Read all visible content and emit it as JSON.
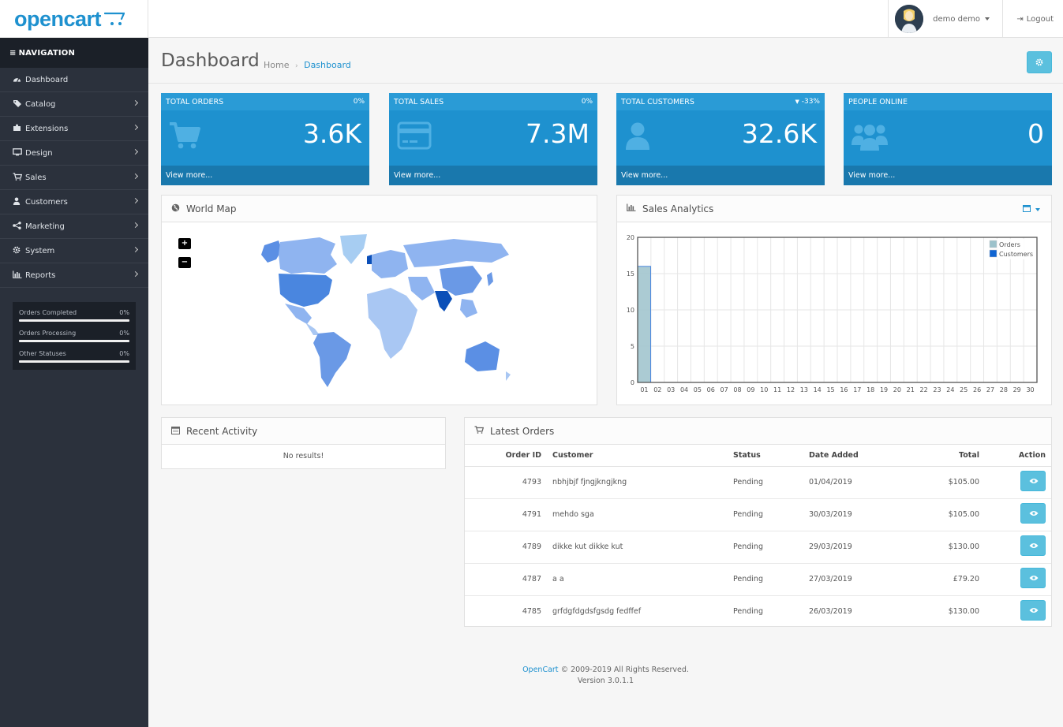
{
  "header": {
    "logo_text": "opencart",
    "user_name": "demo demo",
    "logout_label": "Logout"
  },
  "navigation": {
    "title": "NAVIGATION",
    "items": [
      {
        "label": "Dashboard",
        "icon": "dashboard-icon",
        "has_children": false
      },
      {
        "label": "Catalog",
        "icon": "tag-icon",
        "has_children": true
      },
      {
        "label": "Extensions",
        "icon": "puzzle-icon",
        "has_children": true
      },
      {
        "label": "Design",
        "icon": "monitor-icon",
        "has_children": true
      },
      {
        "label": "Sales",
        "icon": "cart-icon",
        "has_children": true
      },
      {
        "label": "Customers",
        "icon": "user-icon",
        "has_children": true
      },
      {
        "label": "Marketing",
        "icon": "share-icon",
        "has_children": true
      },
      {
        "label": "System",
        "icon": "gear-icon",
        "has_children": true
      },
      {
        "label": "Reports",
        "icon": "bar-chart-icon",
        "has_children": true
      }
    ],
    "order_stats": [
      {
        "label": "Orders Completed",
        "percent": "0%"
      },
      {
        "label": "Orders Processing",
        "percent": "0%"
      },
      {
        "label": "Other Statuses",
        "percent": "0%"
      }
    ]
  },
  "page": {
    "title": "Dashboard",
    "breadcrumb_home": "Home",
    "breadcrumb_current": "Dashboard"
  },
  "tiles": [
    {
      "title": "TOTAL ORDERS",
      "percent": "0%",
      "value": "3.6K",
      "footer": "View more...",
      "icon": "cart-icon"
    },
    {
      "title": "TOTAL SALES",
      "percent": "0%",
      "value": "7.3M",
      "footer": "View more...",
      "icon": "credit-card-icon"
    },
    {
      "title": "TOTAL CUSTOMERS",
      "percent": "-33%",
      "value": "32.6K",
      "footer": "View more...",
      "icon": "user-icon"
    },
    {
      "title": "PEOPLE ONLINE",
      "percent": "",
      "value": "0",
      "footer": "View more...",
      "icon": "users-icon"
    }
  ],
  "world_map": {
    "title": "World Map",
    "zoom_in": "+",
    "zoom_out": "−"
  },
  "sales_analytics": {
    "title": "Sales Analytics"
  },
  "chart_data": {
    "type": "bar",
    "categories": [
      "01",
      "02",
      "03",
      "04",
      "05",
      "06",
      "07",
      "08",
      "09",
      "10",
      "11",
      "12",
      "13",
      "14",
      "15",
      "16",
      "17",
      "18",
      "19",
      "20",
      "21",
      "22",
      "23",
      "24",
      "25",
      "26",
      "27",
      "28",
      "29",
      "30"
    ],
    "series": [
      {
        "name": "Orders",
        "values": [
          16,
          0,
          0,
          0,
          0,
          0,
          0,
          0,
          0,
          0,
          0,
          0,
          0,
          0,
          0,
          0,
          0,
          0,
          0,
          0,
          0,
          0,
          0,
          0,
          0,
          0,
          0,
          0,
          0,
          0
        ],
        "color": "#9cc2cb"
      },
      {
        "name": "Customers",
        "values": [
          0,
          0,
          0,
          0,
          0,
          0,
          0,
          0,
          0,
          0,
          0,
          0,
          0,
          0,
          0,
          0,
          0,
          0,
          0,
          0,
          0,
          0,
          0,
          0,
          0,
          0,
          0,
          0,
          0,
          0
        ],
        "color": "#1065d2"
      }
    ],
    "yticks": [
      "0",
      "5",
      "10",
      "15",
      "20"
    ],
    "ylim": [
      0,
      20
    ],
    "grid": true,
    "legend": "top-right"
  },
  "recent_activity": {
    "title": "Recent Activity",
    "empty_text": "No results!"
  },
  "latest_orders": {
    "title": "Latest Orders",
    "columns": {
      "order_id": "Order ID",
      "customer": "Customer",
      "status": "Status",
      "date_added": "Date Added",
      "total": "Total",
      "action": "Action"
    },
    "rows": [
      {
        "order_id": "4793",
        "customer": "nbhjbjf fjngjkngjkng",
        "status": "Pending",
        "date_added": "01/04/2019",
        "total": "$105.00"
      },
      {
        "order_id": "4791",
        "customer": "mehdo sga",
        "status": "Pending",
        "date_added": "30/03/2019",
        "total": "$105.00"
      },
      {
        "order_id": "4789",
        "customer": "dikke kut dikke kut",
        "status": "Pending",
        "date_added": "29/03/2019",
        "total": "$130.00"
      },
      {
        "order_id": "4787",
        "customer": "a a",
        "status": "Pending",
        "date_added": "27/03/2019",
        "total": "£79.20"
      },
      {
        "order_id": "4785",
        "customer": "grfdgfdgdsfgsdg fedffef",
        "status": "Pending",
        "date_added": "26/03/2019",
        "total": "$130.00"
      }
    ]
  },
  "footer": {
    "brand": "OpenCart",
    "copyright": "© 2009-2019 All Rights Reserved.",
    "version": "Version 3.0.1.1"
  },
  "colors": {
    "brand": "#1e91cf",
    "sidebar": "#2b313c",
    "sidebar_dark": "#1b2028",
    "info_button": "#5bc0de"
  }
}
